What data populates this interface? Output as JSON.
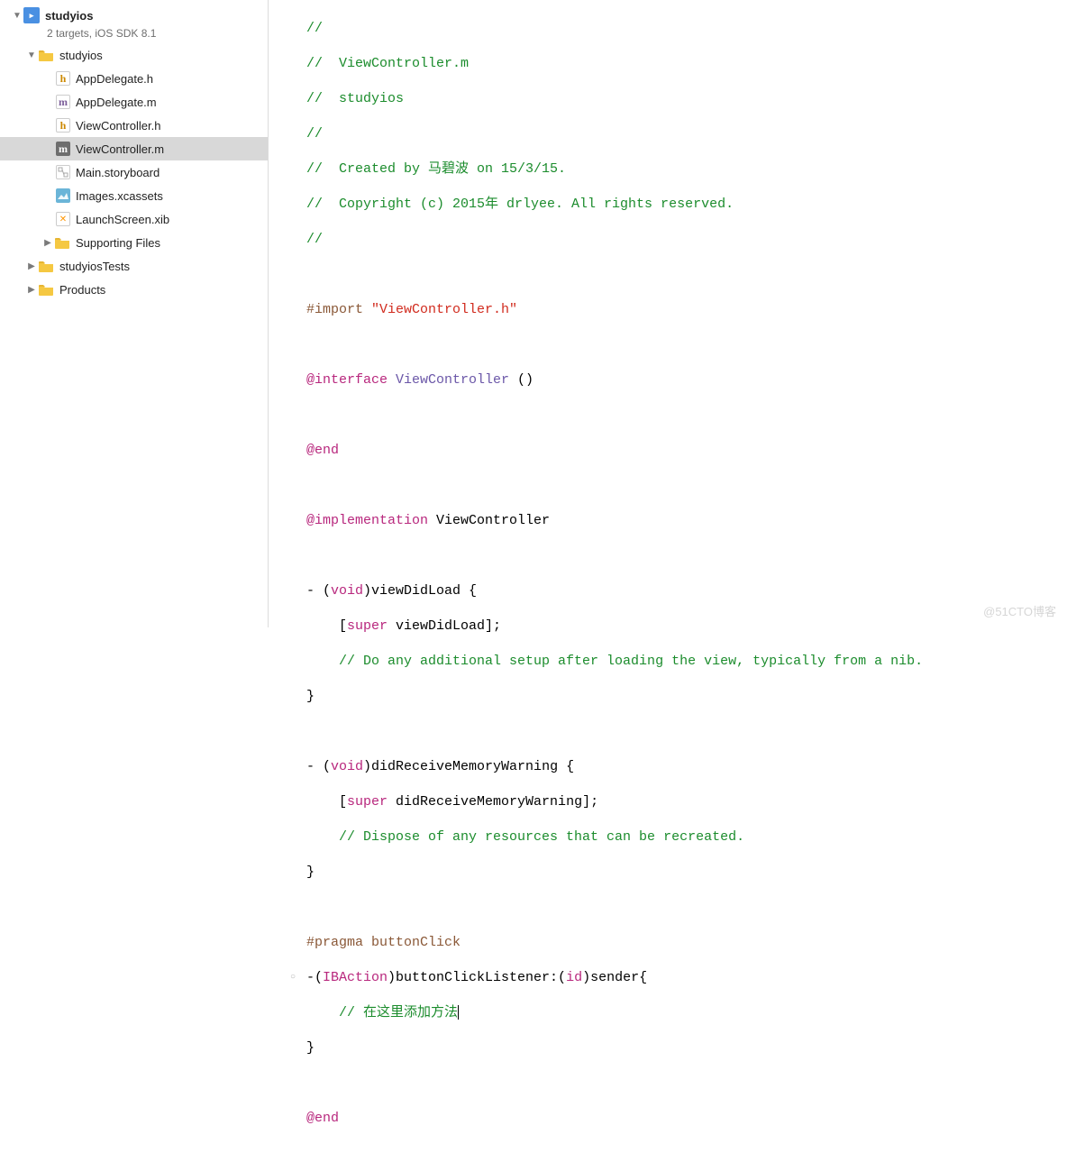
{
  "project": {
    "name": "studyios",
    "subtitle": "2 targets, iOS SDK 8.1"
  },
  "tree": {
    "root_folder": "studyios",
    "files": [
      {
        "name": "AppDelegate.h",
        "icon": "h"
      },
      {
        "name": "AppDelegate.m",
        "icon": "m"
      },
      {
        "name": "ViewController.h",
        "icon": "h"
      },
      {
        "name": "ViewController.m",
        "icon": "m",
        "selected": true
      },
      {
        "name": "Main.storyboard",
        "icon": "storyboard"
      },
      {
        "name": "Images.xcassets",
        "icon": "assets"
      },
      {
        "name": "LaunchScreen.xib",
        "icon": "xib"
      }
    ],
    "supporting_folder": "Supporting Files",
    "tests_folder": "studyiosTests",
    "products_folder": "Products"
  },
  "code": {
    "c1": "//",
    "c2": "//  ViewController.m",
    "c3": "//  studyios",
    "c4": "//",
    "c5": "//  Created by 马碧波 on 15/3/15.",
    "c6": "//  Copyright (c) 2015年 drlyee. All rights reserved.",
    "c7": "//",
    "import_dir": "#import ",
    "import_str": "\"ViewController.h\"",
    "interface_kw": "@interface",
    "interface_cls": " ViewController ",
    "interface_tail": "()",
    "end_kw": "@end",
    "impl_kw": "@implementation",
    "impl_cls": " ViewController",
    "m1_dash": "- (",
    "m1_ret": "void",
    "m1_name": ")viewDidLoad {",
    "m1_super_lb": "    [",
    "m1_super": "super",
    "m1_call": " viewDidLoad];",
    "m1_cm": "    // Do any additional setup after loading the view, typically from a nib.",
    "m_close": "}",
    "m2_dash": "- (",
    "m2_ret": "void",
    "m2_name": ")didReceiveMemoryWarning {",
    "m2_super_lb": "    [",
    "m2_super": "super",
    "m2_call": " didReceiveMemoryWarning];",
    "m2_cm": "    // Dispose of any resources that can be recreated.",
    "pragma": "#pragma buttonClick",
    "m3_dash": "-(",
    "m3_ret": "IBAction",
    "m3_name": ")buttonClickListener:(",
    "m3_arg": "id",
    "m3_tail": ")sender{",
    "m3_cm": "    // 在这里添加方法",
    "end2": "@end"
  },
  "watermark": "@51CTO博客"
}
